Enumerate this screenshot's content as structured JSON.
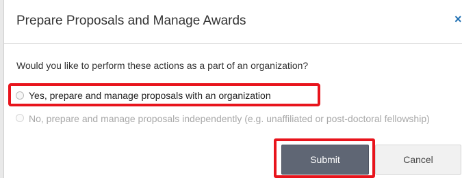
{
  "dialog": {
    "title": "Prepare Proposals and Manage Awards",
    "close_icon": "close-icon",
    "question": "Would you like to perform these actions as a part of an organization?",
    "options": [
      {
        "label": "Yes, prepare and manage proposals with an organization",
        "selected": false,
        "highlighted": true
      },
      {
        "label": "No, prepare and manage proposals independently (e.g. unaffiliated or post-doctoral fellowship)",
        "selected": false,
        "disabled": true
      }
    ],
    "buttons": {
      "submit_label": "Submit",
      "cancel_label": "Cancel"
    }
  },
  "colors": {
    "highlight": "#e8141c",
    "submit_bg": "#5f6674",
    "close_icon": "#1f6fb2",
    "disabled_text": "#a8a8a8"
  }
}
